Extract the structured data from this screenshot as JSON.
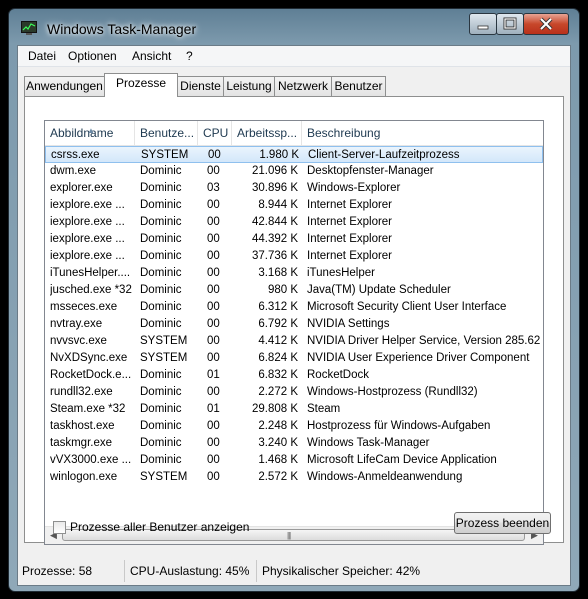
{
  "window": {
    "title": "Windows Task-Manager"
  },
  "menu": [
    "Datei",
    "Optionen",
    "Ansicht",
    "?"
  ],
  "tabs": [
    "Anwendungen",
    "Prozesse",
    "Dienste",
    "Leistung",
    "Netzwerk",
    "Benutzer"
  ],
  "active_tab": "Prozesse",
  "columns": [
    "Abbildname",
    "Benutze...",
    "CPU",
    "Arbeitssp...",
    "Beschreibung"
  ],
  "processes": [
    {
      "name": "csrss.exe",
      "user": "SYSTEM",
      "cpu": "00",
      "mem": "1.980 K",
      "desc": "Client-Server-Laufzeitprozess"
    },
    {
      "name": "dwm.exe",
      "user": "Dominic",
      "cpu": "00",
      "mem": "21.096 K",
      "desc": "Desktopfenster-Manager"
    },
    {
      "name": "explorer.exe",
      "user": "Dominic",
      "cpu": "03",
      "mem": "30.896 K",
      "desc": "Windows-Explorer"
    },
    {
      "name": "iexplore.exe ...",
      "user": "Dominic",
      "cpu": "00",
      "mem": "8.944 K",
      "desc": "Internet Explorer"
    },
    {
      "name": "iexplore.exe ...",
      "user": "Dominic",
      "cpu": "00",
      "mem": "42.844 K",
      "desc": "Internet Explorer"
    },
    {
      "name": "iexplore.exe ...",
      "user": "Dominic",
      "cpu": "00",
      "mem": "44.392 K",
      "desc": "Internet Explorer"
    },
    {
      "name": "iexplore.exe ...",
      "user": "Dominic",
      "cpu": "00",
      "mem": "37.736 K",
      "desc": "Internet Explorer"
    },
    {
      "name": "iTunesHelper....",
      "user": "Dominic",
      "cpu": "00",
      "mem": "3.168 K",
      "desc": "iTunesHelper"
    },
    {
      "name": "jusched.exe *32",
      "user": "Dominic",
      "cpu": "00",
      "mem": "980 K",
      "desc": "Java(TM) Update Scheduler"
    },
    {
      "name": "msseces.exe",
      "user": "Dominic",
      "cpu": "00",
      "mem": "6.312 K",
      "desc": "Microsoft Security Client User Interface"
    },
    {
      "name": "nvtray.exe",
      "user": "Dominic",
      "cpu": "00",
      "mem": "6.792 K",
      "desc": "NVIDIA Settings"
    },
    {
      "name": "nvvsvc.exe",
      "user": "SYSTEM",
      "cpu": "00",
      "mem": "4.412 K",
      "desc": "NVIDIA Driver Helper Service, Version 285.62"
    },
    {
      "name": "NvXDSync.exe",
      "user": "SYSTEM",
      "cpu": "00",
      "mem": "6.824 K",
      "desc": "NVIDIA User Experience Driver Component"
    },
    {
      "name": "RocketDock.e...",
      "user": "Dominic",
      "cpu": "01",
      "mem": "6.832 K",
      "desc": "RocketDock"
    },
    {
      "name": "rundll32.exe",
      "user": "Dominic",
      "cpu": "00",
      "mem": "2.272 K",
      "desc": "Windows-Hostprozess (Rundll32)"
    },
    {
      "name": "Steam.exe *32",
      "user": "Dominic",
      "cpu": "01",
      "mem": "29.808 K",
      "desc": "Steam"
    },
    {
      "name": "taskhost.exe",
      "user": "Dominic",
      "cpu": "00",
      "mem": "2.248 K",
      "desc": "Hostprozess für Windows-Aufgaben"
    },
    {
      "name": "taskmgr.exe",
      "user": "Dominic",
      "cpu": "00",
      "mem": "3.240 K",
      "desc": "Windows Task-Manager"
    },
    {
      "name": "vVX3000.exe ...",
      "user": "Dominic",
      "cpu": "00",
      "mem": "1.468 K",
      "desc": "Microsoft LifeCam Device Application"
    },
    {
      "name": "winlogon.exe",
      "user": "SYSTEM",
      "cpu": "00",
      "mem": "2.572 K",
      "desc": "Windows-Anmeldeanwendung"
    }
  ],
  "show_all_label": "Prozesse aller Benutzer anzeigen",
  "end_process_label": "Prozess beenden",
  "status": {
    "processes": "Prozesse: 58",
    "cpu": "CPU-Auslastung: 45%",
    "memory": "Physikalischer Speicher: 42%"
  }
}
